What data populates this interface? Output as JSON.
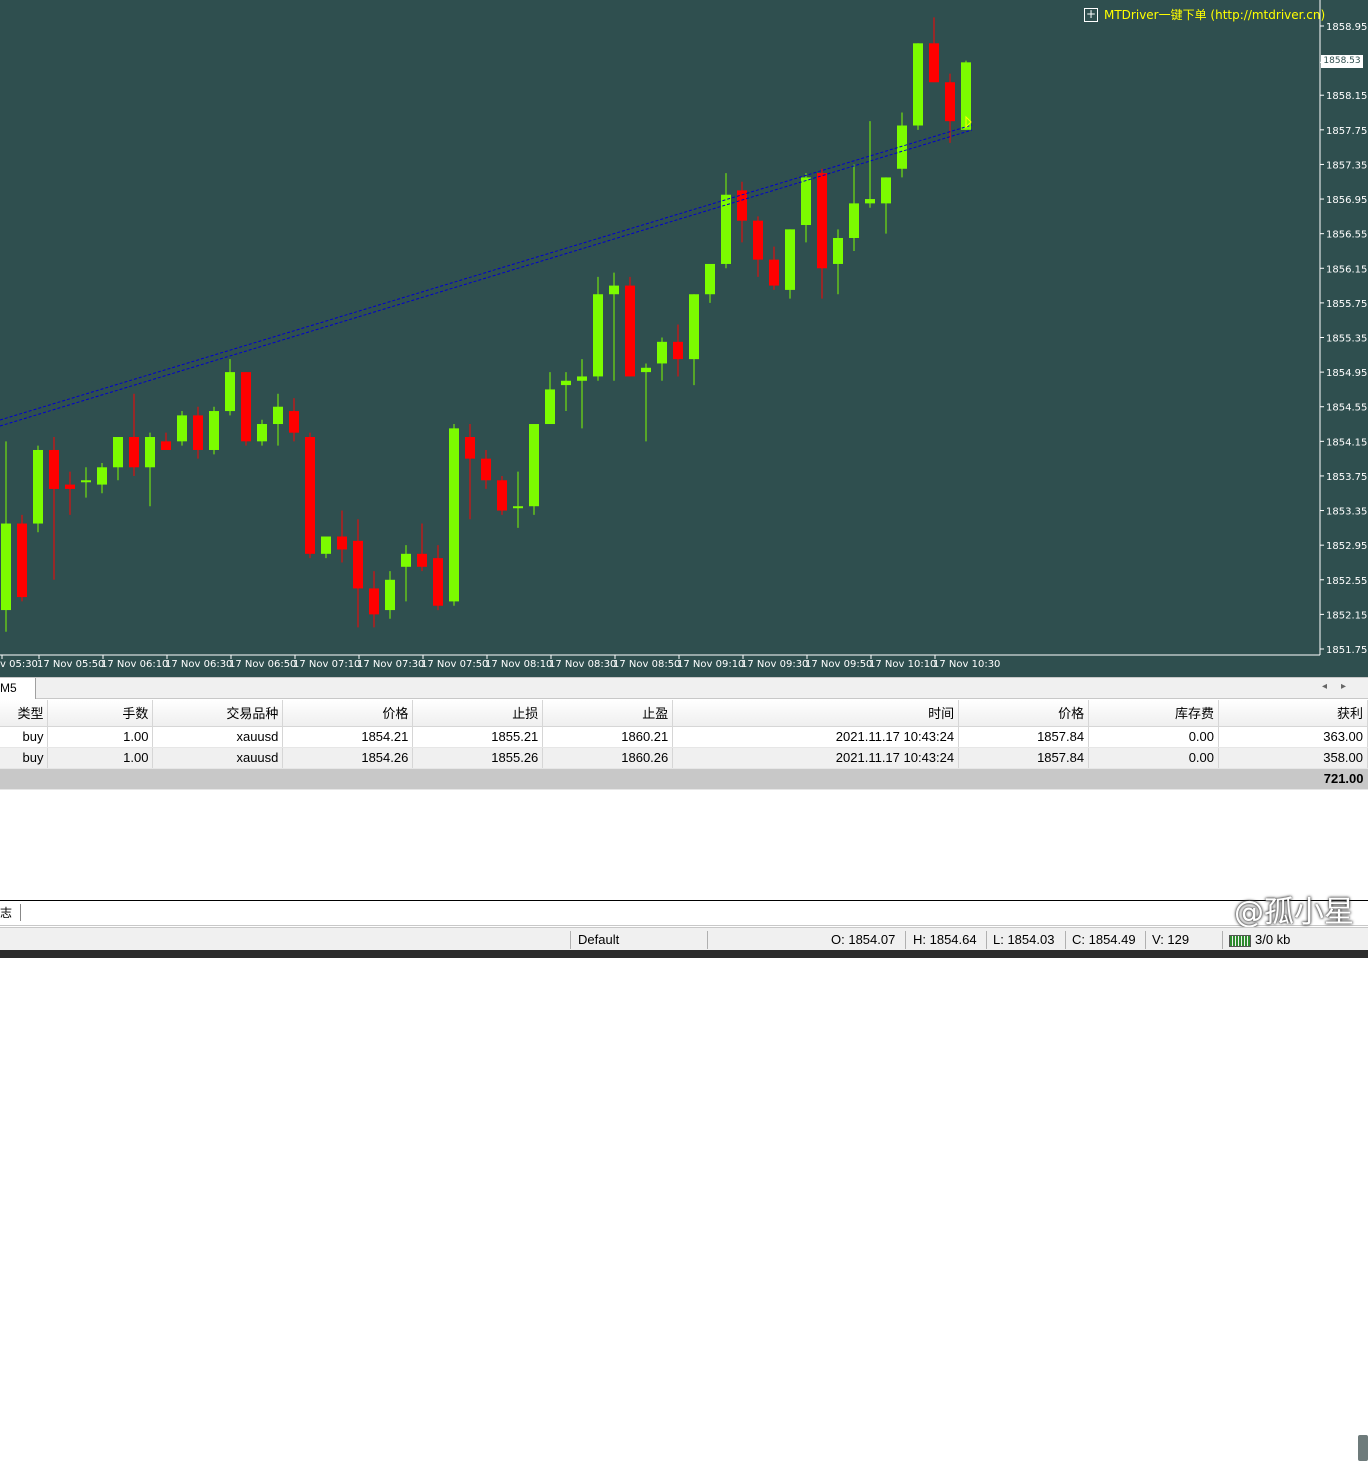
{
  "chart": {
    "watermark_link": "MTDriver一键下单 (http://mtdriver.cn)",
    "current_price": "1858.53",
    "price_axis": [
      "1858.95",
      "1858.53",
      "1858.15",
      "1857.75",
      "1857.35",
      "1856.95",
      "1856.55",
      "1856.15",
      "1855.75",
      "1855.35",
      "1854.95",
      "1854.55",
      "1854.15",
      "1853.75",
      "1853.35",
      "1852.95",
      "1852.55",
      "1852.15",
      "1851.75"
    ],
    "time_axis": [
      "v 05:30",
      "17 Nov 05:50",
      "17 Nov 06:10",
      "17 Nov 06:30",
      "17 Nov 06:50",
      "17 Nov 07:10",
      "17 Nov 07:30",
      "17 Nov 07:50",
      "17 Nov 08:10",
      "17 Nov 08:30",
      "17 Nov 08:50",
      "17 Nov 09:10",
      "17 Nov 09:30",
      "17 Nov 09:50",
      "17 Nov 10:10",
      "17 Nov 10:30"
    ],
    "bull_color": "#7cfc00",
    "bear_color": "#ff0000",
    "bg_color": "#2f4f4f",
    "candles": [
      {
        "o": 1852.2,
        "h": 1854.15,
        "l": 1851.95,
        "c": 1853.2
      },
      {
        "o": 1853.2,
        "h": 1853.3,
        "l": 1852.3,
        "c": 1852.35
      },
      {
        "o": 1853.2,
        "h": 1854.1,
        "l": 1853.1,
        "c": 1854.05
      },
      {
        "o": 1854.05,
        "h": 1854.2,
        "l": 1852.55,
        "c": 1853.6
      },
      {
        "o": 1853.65,
        "h": 1853.8,
        "l": 1853.3,
        "c": 1853.6
      },
      {
        "o": 1853.7,
        "h": 1853.85,
        "l": 1853.5,
        "c": 1853.7
      },
      {
        "o": 1853.65,
        "h": 1853.9,
        "l": 1853.55,
        "c": 1853.85
      },
      {
        "o": 1853.85,
        "h": 1854.2,
        "l": 1853.7,
        "c": 1854.2
      },
      {
        "o": 1854.2,
        "h": 1854.7,
        "l": 1853.75,
        "c": 1853.85
      },
      {
        "o": 1853.85,
        "h": 1854.25,
        "l": 1853.4,
        "c": 1854.2
      },
      {
        "o": 1854.15,
        "h": 1854.25,
        "l": 1854.05,
        "c": 1854.05
      },
      {
        "o": 1854.15,
        "h": 1854.5,
        "l": 1854.1,
        "c": 1854.45
      },
      {
        "o": 1854.45,
        "h": 1854.55,
        "l": 1853.95,
        "c": 1854.05
      },
      {
        "o": 1854.05,
        "h": 1854.55,
        "l": 1854.0,
        "c": 1854.5
      },
      {
        "o": 1854.5,
        "h": 1855.1,
        "l": 1854.45,
        "c": 1854.95
      },
      {
        "o": 1854.95,
        "h": 1854.95,
        "l": 1854.1,
        "c": 1854.15
      },
      {
        "o": 1854.15,
        "h": 1854.4,
        "l": 1854.1,
        "c": 1854.35
      },
      {
        "o": 1854.35,
        "h": 1854.7,
        "l": 1854.1,
        "c": 1854.55
      },
      {
        "o": 1854.5,
        "h": 1854.65,
        "l": 1854.15,
        "c": 1854.25
      },
      {
        "o": 1854.2,
        "h": 1854.25,
        "l": 1852.8,
        "c": 1852.85
      },
      {
        "o": 1852.85,
        "h": 1853.0,
        "l": 1852.8,
        "c": 1853.05
      },
      {
        "o": 1853.05,
        "h": 1853.35,
        "l": 1852.75,
        "c": 1852.9
      },
      {
        "o": 1853.0,
        "h": 1853.25,
        "l": 1852.0,
        "c": 1852.45
      },
      {
        "o": 1852.45,
        "h": 1852.65,
        "l": 1852.0,
        "c": 1852.15
      },
      {
        "o": 1852.2,
        "h": 1852.65,
        "l": 1852.1,
        "c": 1852.55
      },
      {
        "o": 1852.7,
        "h": 1852.95,
        "l": 1852.3,
        "c": 1852.85
      },
      {
        "o": 1852.85,
        "h": 1853.2,
        "l": 1852.65,
        "c": 1852.7
      },
      {
        "o": 1852.8,
        "h": 1852.95,
        "l": 1852.2,
        "c": 1852.25
      },
      {
        "o": 1852.3,
        "h": 1854.35,
        "l": 1852.25,
        "c": 1854.3
      },
      {
        "o": 1854.2,
        "h": 1854.35,
        "l": 1853.25,
        "c": 1853.95
      },
      {
        "o": 1853.95,
        "h": 1854.05,
        "l": 1853.6,
        "c": 1853.7
      },
      {
        "o": 1853.7,
        "h": 1853.75,
        "l": 1853.3,
        "c": 1853.35
      },
      {
        "o": 1853.4,
        "h": 1853.8,
        "l": 1853.15,
        "c": 1853.4
      },
      {
        "o": 1853.4,
        "h": 1854.35,
        "l": 1853.3,
        "c": 1854.35
      },
      {
        "o": 1854.35,
        "h": 1854.95,
        "l": 1854.35,
        "c": 1854.75
      },
      {
        "o": 1854.8,
        "h": 1854.95,
        "l": 1854.5,
        "c": 1854.85
      },
      {
        "o": 1854.85,
        "h": 1855.1,
        "l": 1854.3,
        "c": 1854.9
      },
      {
        "o": 1854.9,
        "h": 1856.05,
        "l": 1854.85,
        "c": 1855.85
      },
      {
        "o": 1855.85,
        "h": 1856.1,
        "l": 1854.85,
        "c": 1855.95
      },
      {
        "o": 1855.95,
        "h": 1856.05,
        "l": 1854.9,
        "c": 1854.9
      },
      {
        "o": 1854.95,
        "h": 1855.05,
        "l": 1854.15,
        "c": 1855.0
      },
      {
        "o": 1855.05,
        "h": 1855.35,
        "l": 1854.85,
        "c": 1855.3
      },
      {
        "o": 1855.3,
        "h": 1855.5,
        "l": 1854.9,
        "c": 1855.1
      },
      {
        "o": 1855.1,
        "h": 1855.85,
        "l": 1854.8,
        "c": 1855.85
      },
      {
        "o": 1855.85,
        "h": 1856.2,
        "l": 1855.75,
        "c": 1856.2
      },
      {
        "o": 1856.2,
        "h": 1857.25,
        "l": 1856.15,
        "c": 1857.0
      },
      {
        "o": 1857.05,
        "h": 1857.15,
        "l": 1856.45,
        "c": 1856.7
      },
      {
        "o": 1856.7,
        "h": 1856.75,
        "l": 1856.05,
        "c": 1856.25
      },
      {
        "o": 1856.25,
        "h": 1856.4,
        "l": 1855.9,
        "c": 1855.95
      },
      {
        "o": 1855.9,
        "h": 1856.6,
        "l": 1855.8,
        "c": 1856.6
      },
      {
        "o": 1856.65,
        "h": 1857.25,
        "l": 1856.45,
        "c": 1857.2
      },
      {
        "o": 1857.25,
        "h": 1857.3,
        "l": 1855.8,
        "c": 1856.15
      },
      {
        "o": 1856.2,
        "h": 1856.6,
        "l": 1855.85,
        "c": 1856.5
      },
      {
        "o": 1856.5,
        "h": 1857.35,
        "l": 1856.35,
        "c": 1856.9
      },
      {
        "o": 1856.9,
        "h": 1857.85,
        "l": 1856.85,
        "c": 1856.95
      },
      {
        "o": 1856.9,
        "h": 1857.2,
        "l": 1856.55,
        "c": 1857.2
      },
      {
        "o": 1857.3,
        "h": 1857.95,
        "l": 1857.2,
        "c": 1857.8
      },
      {
        "o": 1857.8,
        "h": 1858.75,
        "l": 1857.75,
        "c": 1858.75
      },
      {
        "o": 1858.75,
        "h": 1859.05,
        "l": 1858.3,
        "c": 1858.3
      },
      {
        "o": 1858.3,
        "h": 1858.4,
        "l": 1857.6,
        "c": 1857.85
      },
      {
        "o": 1857.75,
        "h": 1858.55,
        "l": 1857.75,
        "c": 1858.53
      }
    ]
  },
  "tabs": {
    "timeframe": "M5",
    "log_tab": "志"
  },
  "table": {
    "columns": [
      "类型",
      "手数",
      "交易品种",
      "价格",
      "止损",
      "止盈",
      "时间",
      "价格",
      "库存费",
      "获利"
    ],
    "rows": [
      [
        "buy",
        "1.00",
        "xauusd",
        "1854.21",
        "1855.21",
        "1860.21",
        "2021.11.17 10:43:24",
        "1857.84",
        "0.00",
        "363.00"
      ],
      [
        "buy",
        "1.00",
        "xauusd",
        "1854.26",
        "1855.26",
        "1860.26",
        "2021.11.17 10:43:24",
        "1857.84",
        "0.00",
        "358.00"
      ]
    ],
    "total": "721.00"
  },
  "watermark": "@孤小星",
  "status": {
    "profile": "Default",
    "open": "O: 1854.07",
    "high": "H: 1854.64",
    "low": "L: 1854.03",
    "close": "C: 1854.49",
    "volume": "V: 129",
    "traffic": "3/0 kb"
  }
}
